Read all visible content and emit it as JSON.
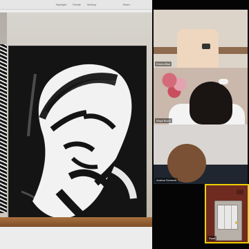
{
  "top_bar": {
    "items": [
      "Highlight",
      "Rotate",
      "Markup",
      "Share"
    ]
  },
  "participants": [
    {
      "name": "Emma Blye"
    },
    {
      "name": "Maya Bucki"
    },
    {
      "name": "Andrea Schneck"
    },
    {
      "name": "Ryan"
    }
  ],
  "colors": {
    "active_speaker_border": "#f0d100"
  }
}
